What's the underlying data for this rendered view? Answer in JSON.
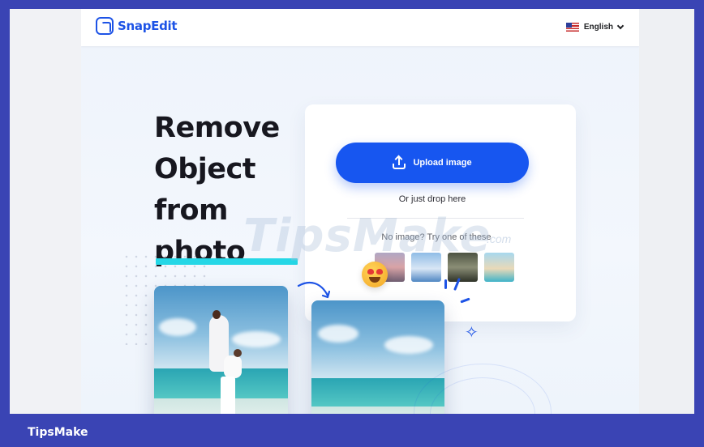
{
  "header": {
    "logo_text": "SnapEdit",
    "language": "English",
    "language_flag": "us-flag-icon"
  },
  "hero": {
    "headline_lines": [
      "Remove",
      "Object",
      "from",
      "photo"
    ],
    "accent_color": "#25d7e6"
  },
  "upload_card": {
    "upload_button_label": "Upload image",
    "drop_hint": "Or just drop here",
    "sample_prompt": "No image? Try one of these",
    "sample_count": 4
  },
  "colors": {
    "brand_blue": "#1d53e6",
    "button_blue": "#1756f0",
    "frame_blue": "#3a44b4"
  },
  "watermark": {
    "text": "TipsMake",
    "domain": ".com"
  },
  "footer": {
    "brand": "TipsMake"
  }
}
